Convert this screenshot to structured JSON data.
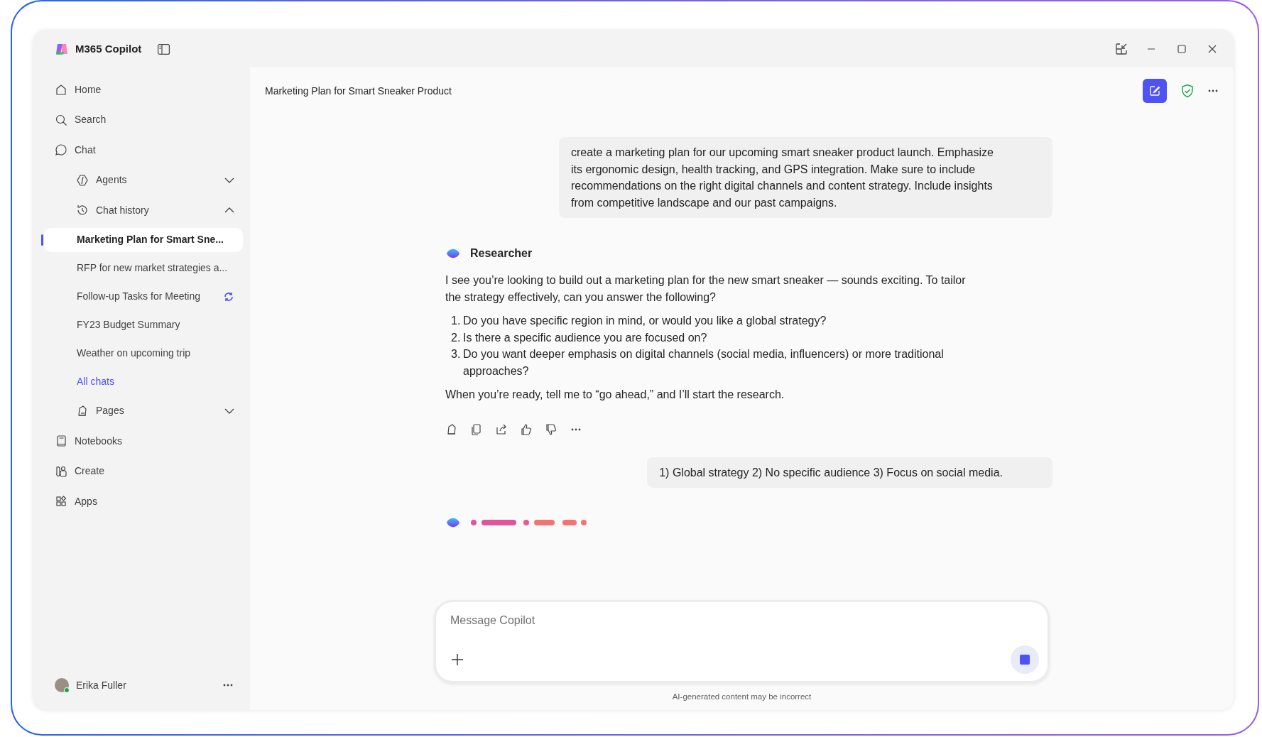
{
  "app": {
    "title": "M365 Copilot"
  },
  "sidebar": {
    "nav": [
      {
        "label": "Home",
        "kind": "top"
      },
      {
        "label": "Search",
        "kind": "top"
      },
      {
        "label": "Chat",
        "kind": "top",
        "children": [
          {
            "label": "Agents",
            "kind": "group",
            "expanded": false
          },
          {
            "label": "Chat history",
            "kind": "group",
            "expanded": true,
            "children": [
              {
                "label": "Marketing Plan for Smart Sne...",
                "kind": "chat",
                "selected": true,
                "syncing": false
              },
              {
                "label": "RFP for new market strategies a...",
                "kind": "chat",
                "selected": false,
                "syncing": false
              },
              {
                "label": "Follow-up Tasks for Meeting",
                "kind": "chat",
                "selected": false,
                "syncing": true
              },
              {
                "label": "FY23 Budget Summary",
                "kind": "chat",
                "selected": false,
                "syncing": false
              },
              {
                "label": "Weather on upcoming trip",
                "kind": "chat",
                "selected": false,
                "syncing": false
              },
              {
                "label": "All chats",
                "kind": "link"
              }
            ]
          },
          {
            "label": "Pages",
            "kind": "group",
            "expanded": false
          }
        ]
      },
      {
        "label": "Notebooks",
        "kind": "top"
      },
      {
        "label": "Create",
        "kind": "top"
      },
      {
        "label": "Apps",
        "kind": "top"
      }
    ],
    "user": {
      "name": "Erika Fuller",
      "online": true
    }
  },
  "chat": {
    "title": "Marketing Plan for Smart Sneaker Product",
    "messages": [
      {
        "kind": "user",
        "text": "create a marketing plan for our upcoming smart sneaker product launch. Emphasize its ergonomic design, health tracking, and GPS integration. Make sure to include recommendations on the right digital channels and content strategy. Include insights from competitive landscape and our past campaigns."
      },
      {
        "kind": "assistant",
        "author": "Researcher",
        "intro": "I see you’re looking to build out a marketing plan for the new smart sneaker — sounds exciting. To tailor the strategy effectively, can you answer the following?",
        "list": [
          {
            "number": "1.",
            "text": "Do you have specific region in mind, or would you like a global strategy?"
          },
          {
            "number": "2.",
            "text": "Is there a specific audience you are focused on?"
          },
          {
            "number": "3.",
            "text": "Do you want deeper emphasis on digital channels (social media, influencers) or more traditional approaches?"
          }
        ],
        "closing": "When you’re ready, tell me to “go ahead,” and I’ll start the research."
      },
      {
        "kind": "user",
        "text": "1) Global strategy 2) No specific audience 3) Focus on social media."
      },
      {
        "kind": "typing"
      }
    ],
    "input": {
      "placeholder": "Message Copilot"
    },
    "disclaimer": "AI-generated content may be incorrect"
  }
}
